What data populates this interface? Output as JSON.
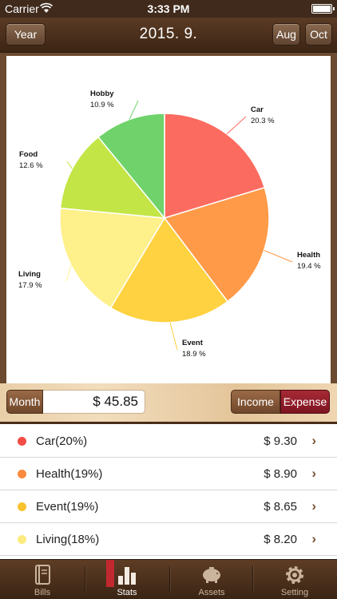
{
  "status_bar": {
    "carrier": "Carrier",
    "time": "3:33 PM"
  },
  "nav": {
    "left_button": "Year",
    "title": "2015. 9.",
    "prev_button": "Aug",
    "next_button": "Oct"
  },
  "chart_data": {
    "type": "pie",
    "slices": [
      {
        "label": "Car",
        "percent_text": "20.3 %",
        "value": 20.3,
        "color": "#FC6B60"
      },
      {
        "label": "Health",
        "percent_text": "19.4 %",
        "value": 19.4,
        "color": "#FE9A48"
      },
      {
        "label": "Event",
        "percent_text": "18.9 %",
        "value": 18.9,
        "color": "#FED240"
      },
      {
        "label": "Living",
        "percent_text": "17.9 %",
        "value": 17.9,
        "color": "#FEF08A"
      },
      {
        "label": "Food",
        "percent_text": "12.6 %",
        "value": 12.6,
        "color": "#C3E545"
      },
      {
        "label": "Hobby",
        "percent_text": "10.9 %",
        "value": 10.9,
        "color": "#6FD26B"
      }
    ]
  },
  "summary": {
    "period_label": "Month",
    "amount": "$ 45.85",
    "income_label": "Income",
    "expense_label": "Expense"
  },
  "list": [
    {
      "name": "Car(20%)",
      "amount": "$ 9.30",
      "color": "#F24D46"
    },
    {
      "name": "Health(19%)",
      "amount": "$ 8.90",
      "color": "#F98A3E"
    },
    {
      "name": "Event(19%)",
      "amount": "$ 8.65",
      "color": "#F9C22F"
    },
    {
      "name": "Living(18%)",
      "amount": "$ 8.20",
      "color": "#FBEB7E"
    }
  ],
  "tabs": [
    {
      "label": "Bills",
      "icon": "bills-book-icon"
    },
    {
      "label": "Stats",
      "icon": "stats-bars-icon"
    },
    {
      "label": "Assets",
      "icon": "piggy-bank-icon"
    },
    {
      "label": "Setting",
      "icon": "gear-icon"
    }
  ]
}
